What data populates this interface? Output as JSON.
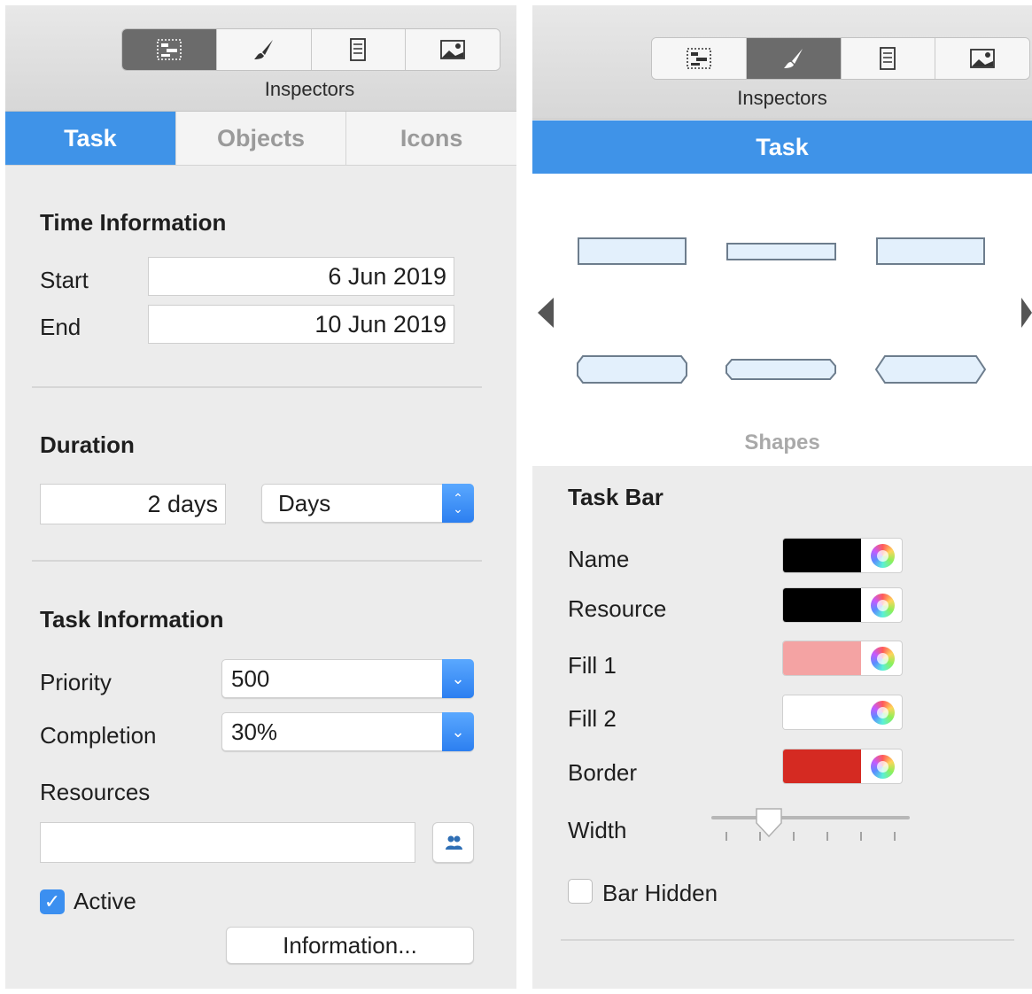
{
  "left_panel": {
    "inspectors_label": "Inspectors",
    "toolbar": [
      "gantt-icon",
      "paintbrush-icon",
      "document-icon",
      "image-icon"
    ],
    "tabs": [
      {
        "label": "Task",
        "active": true
      },
      {
        "label": "Objects",
        "active": false
      },
      {
        "label": "Icons",
        "active": false
      }
    ],
    "time_information": {
      "title": "Time Information",
      "start_label": "Start",
      "start_value": "6 Jun 2019",
      "end_label": "End",
      "end_value": "10 Jun 2019"
    },
    "duration": {
      "title": "Duration",
      "value": "2 days",
      "unit": "Days"
    },
    "task_information": {
      "title": "Task Information",
      "priority_label": "Priority",
      "priority_value": "500",
      "completion_label": "Completion",
      "completion_value": "30%",
      "resources_label": "Resources",
      "resources_value": "",
      "active_label": "Active",
      "active_checked": true,
      "information_button": "Information..."
    }
  },
  "right_panel": {
    "inspectors_label": "Inspectors",
    "toolbar": [
      "gantt-icon",
      "paintbrush-icon",
      "document-icon",
      "image-icon"
    ],
    "tab_label": "Task",
    "shapes_label": "Shapes",
    "task_bar": {
      "title": "Task Bar",
      "rows": [
        {
          "label": "Name",
          "color": "#000000"
        },
        {
          "label": "Resource",
          "color": "#000000"
        },
        {
          "label": "Fill 1",
          "color": "#f4a3a3"
        },
        {
          "label": "Fill 2",
          "color": "#ffffff"
        },
        {
          "label": "Border",
          "color": "#d52a22"
        }
      ],
      "width_label": "Width",
      "width_level": 0.25,
      "bar_hidden_label": "Bar Hidden",
      "bar_hidden_checked": false
    }
  }
}
